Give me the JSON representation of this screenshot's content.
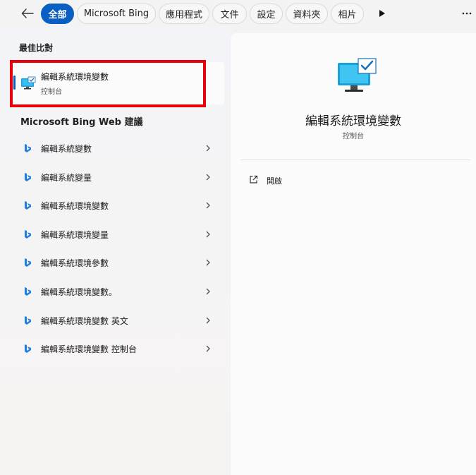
{
  "filters": {
    "items": [
      "全部",
      "Microsoft Bing",
      "應用程式",
      "文件",
      "設定",
      "資料夾",
      "相片"
    ],
    "active_index": 0
  },
  "best_match": {
    "section_label": "最佳比對",
    "title": "編輯系統環境變數",
    "subtitle": "控制台",
    "icon": "monitor-check-icon"
  },
  "web_suggestions": {
    "section_label": "Microsoft Bing Web 建議",
    "items": [
      "編輯系統變數",
      "編輯系統變量",
      "編輯系統環境變數",
      "編輯系統環境變量",
      "編輯系統環境參數",
      "編輯系統環境變數。",
      "編輯系統環境變數 英文",
      "編輯系統環境變數 控制台"
    ],
    "icon": "bing-icon"
  },
  "detail": {
    "title": "編輯系統環境變數",
    "subtitle": "控制台",
    "actions": [
      {
        "label": "開啟",
        "icon": "open-external-icon"
      }
    ]
  },
  "colors": {
    "accent": "#0a5fc2",
    "highlight": "#e8000b",
    "bing_blue": "#1f7fe0"
  }
}
